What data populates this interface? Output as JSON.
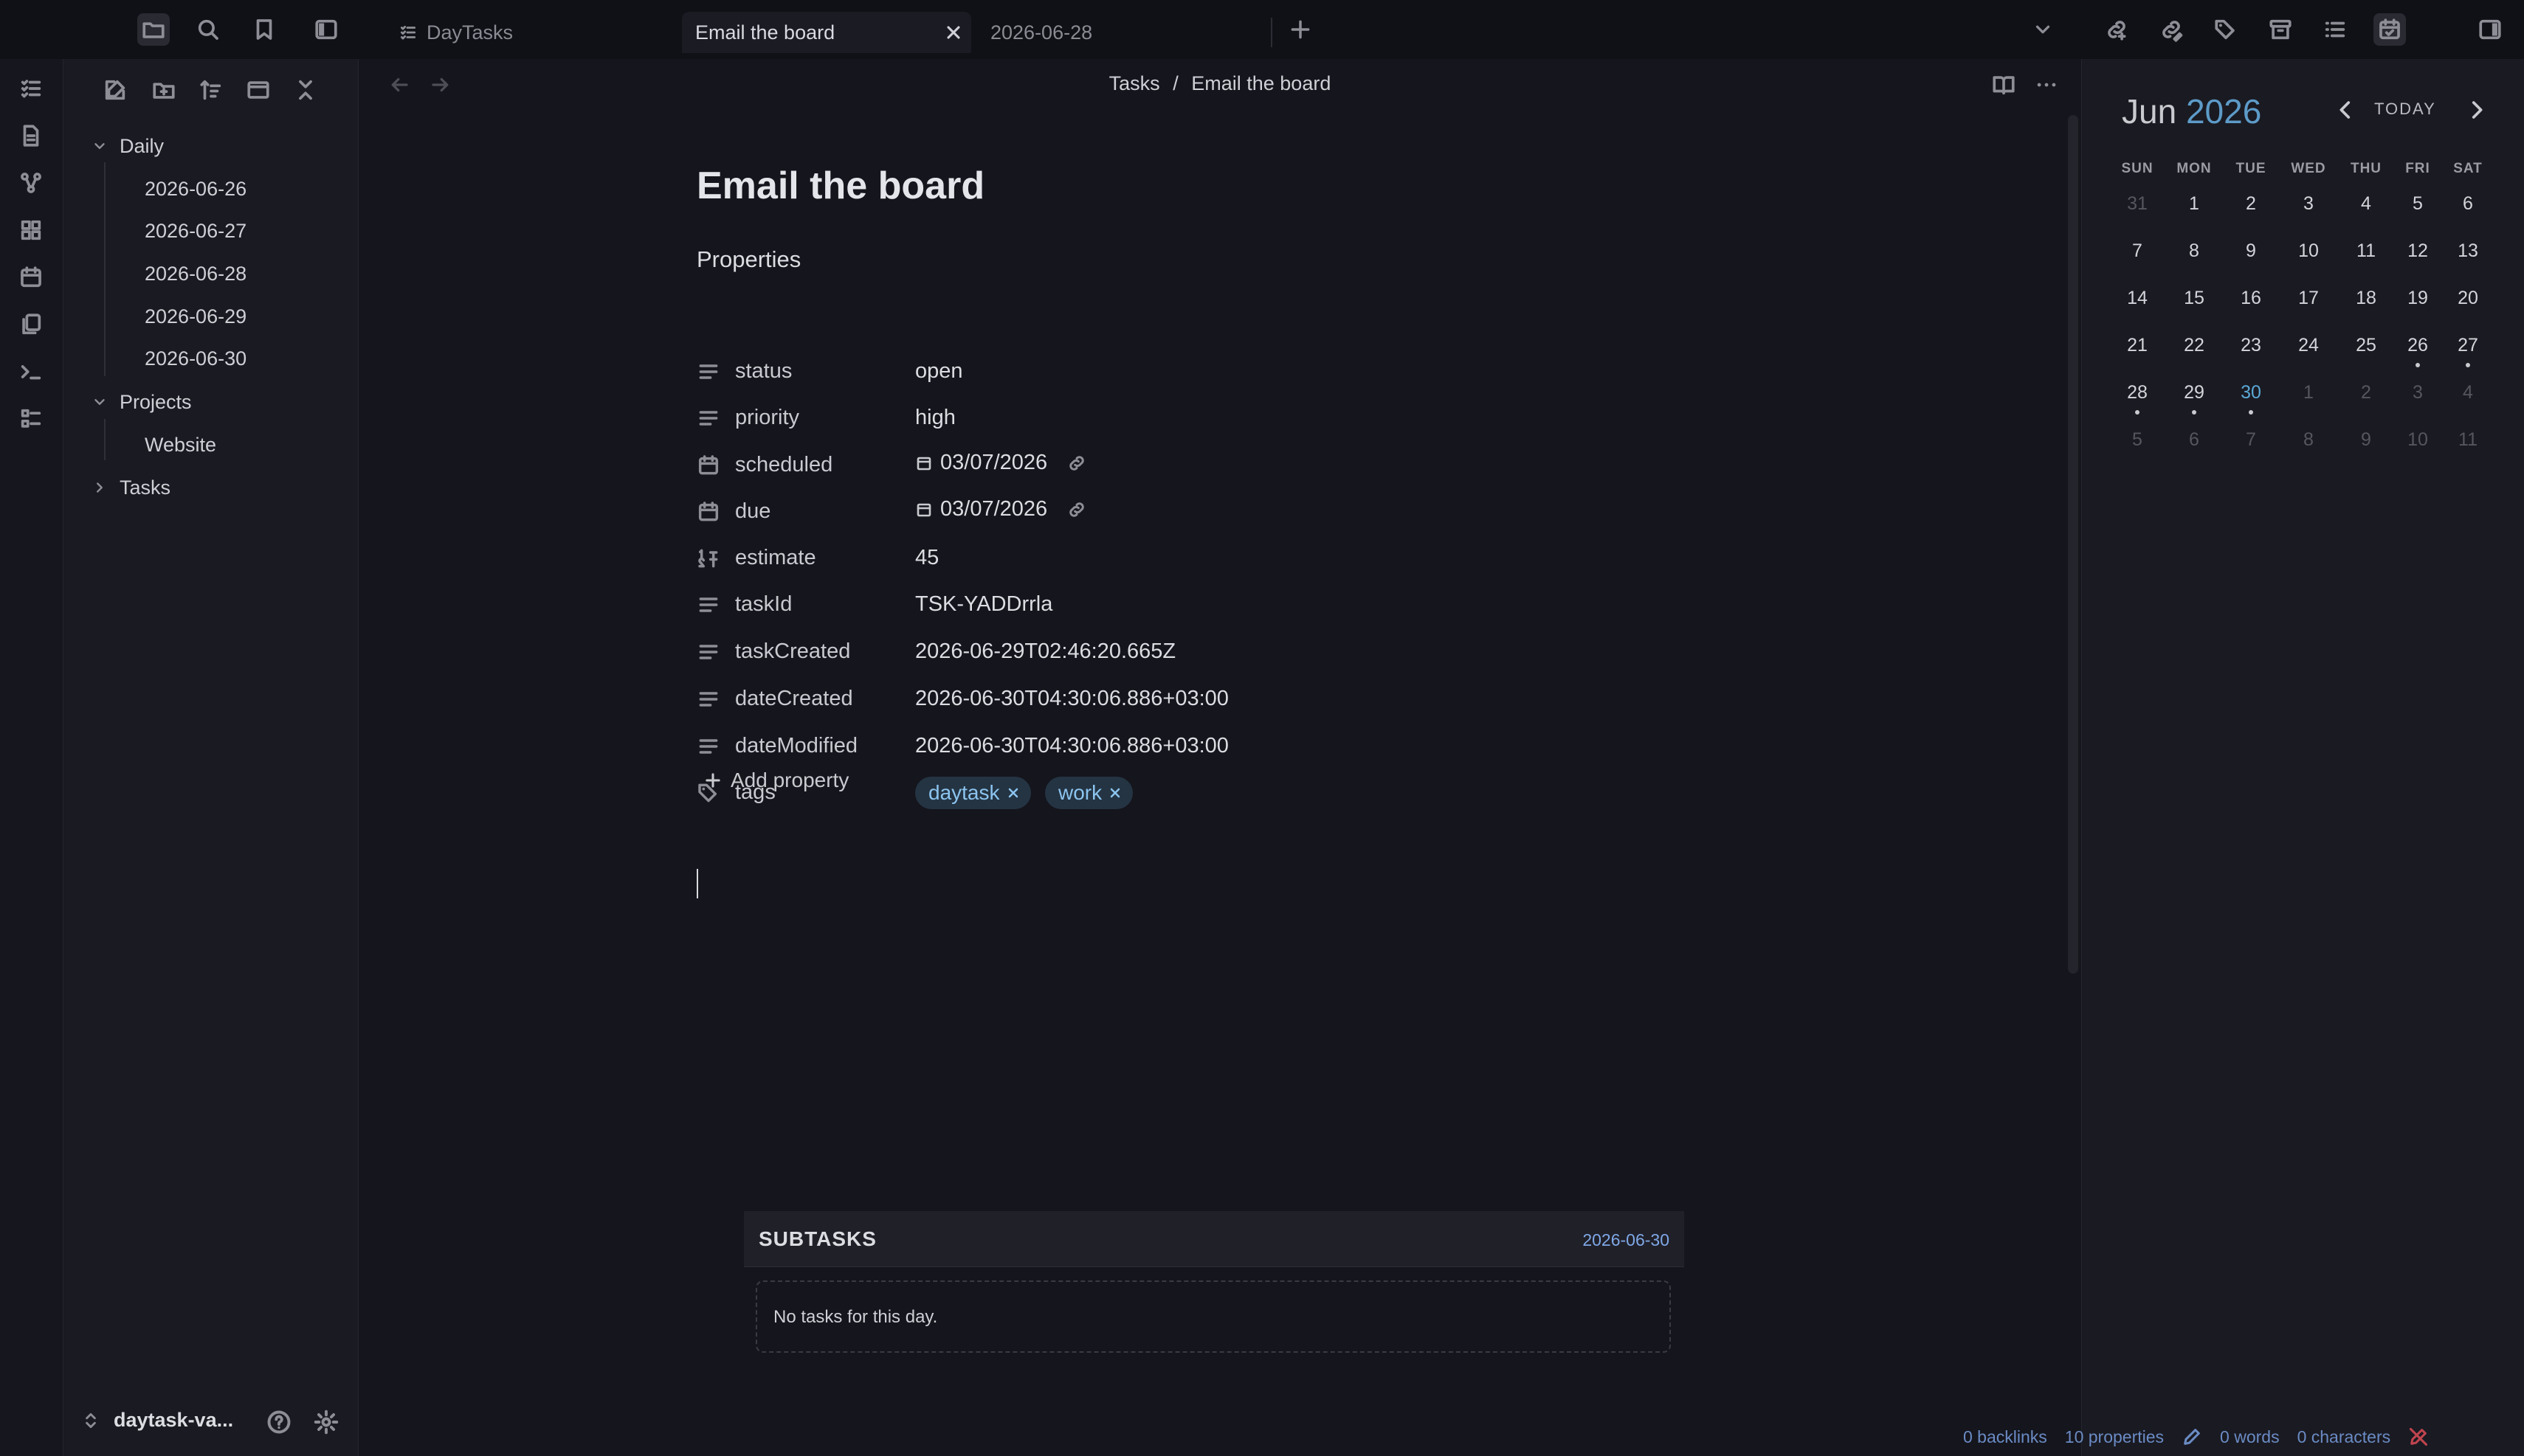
{
  "tabs": [
    {
      "label": "DayTasks",
      "active": false
    },
    {
      "label": "Email the board",
      "active": true
    },
    {
      "label": "2026-06-28",
      "active": false
    }
  ],
  "sidebar": {
    "tree": [
      {
        "label": "Daily",
        "expanded": true,
        "children": [
          "2026-06-26",
          "2026-06-27",
          "2026-06-28",
          "2026-06-29",
          "2026-06-30"
        ]
      },
      {
        "label": "Projects",
        "expanded": true,
        "children": [
          "Website"
        ]
      },
      {
        "label": "Tasks",
        "expanded": false,
        "children": []
      }
    ],
    "vault_name": "daytask-va..."
  },
  "breadcrumb": {
    "parent": "Tasks",
    "separator": "/",
    "current": "Email the board"
  },
  "document": {
    "title": "Email the board",
    "properties_heading": "Properties",
    "properties": [
      {
        "key": "status",
        "value": "open",
        "icon": "text-lines-icon"
      },
      {
        "key": "priority",
        "value": "high",
        "icon": "text-lines-icon"
      },
      {
        "key": "scheduled",
        "value": "03/07/2026",
        "icon": "calendar-icon"
      },
      {
        "key": "due",
        "value": "03/07/2026",
        "icon": "calendar-icon"
      },
      {
        "key": "estimate",
        "value": "45",
        "icon": "number-icon"
      },
      {
        "key": "taskId",
        "value": "TSK-YADDrrla",
        "icon": "text-lines-icon"
      },
      {
        "key": "taskCreated",
        "value": "2026-06-29T02:46:20.665Z",
        "icon": "text-lines-icon"
      },
      {
        "key": "dateCreated",
        "value": "2026-06-30T04:30:06.886+03:00",
        "icon": "text-lines-icon"
      },
      {
        "key": "dateModified",
        "value": "2026-06-30T04:30:06.886+03:00",
        "icon": "text-lines-icon"
      },
      {
        "key": "tags",
        "tags": [
          "daytask",
          "work"
        ],
        "icon": "tag-icon"
      }
    ],
    "add_property_label": "Add property"
  },
  "subtasks": {
    "title": "SUBTASKS",
    "date": "2026-06-30",
    "empty_text": "No tasks for this day."
  },
  "calendar": {
    "month": "Jun",
    "year": "2026",
    "today_label": "TODAY",
    "weekdays": [
      "SUN",
      "MON",
      "TUE",
      "WED",
      "THU",
      "FRI",
      "SAT"
    ],
    "weeks": [
      [
        "31",
        "1",
        "2",
        "3",
        "4",
        "5",
        "6"
      ],
      [
        "7",
        "8",
        "9",
        "10",
        "11",
        "12",
        "13"
      ],
      [
        "14",
        "15",
        "16",
        "17",
        "18",
        "19",
        "20"
      ],
      [
        "21",
        "22",
        "23",
        "24",
        "25",
        "26",
        "27"
      ],
      [
        "28",
        "29",
        "30",
        "1",
        "2",
        "3",
        "4"
      ],
      [
        "5",
        "6",
        "7",
        "8",
        "9",
        "10",
        "11"
      ]
    ],
    "today": "30",
    "days_with_notes": [
      "26",
      "27",
      "28",
      "29",
      "30"
    ]
  },
  "statusbar": {
    "backlinks": "0 backlinks",
    "properties": "10 properties",
    "words": "0 words",
    "characters": "0 characters"
  },
  "colors": {
    "accent": "#5aa8d6",
    "tag_bg": "#243443",
    "tag_text": "#8cc4ef",
    "status_link": "#6a8bc4"
  }
}
